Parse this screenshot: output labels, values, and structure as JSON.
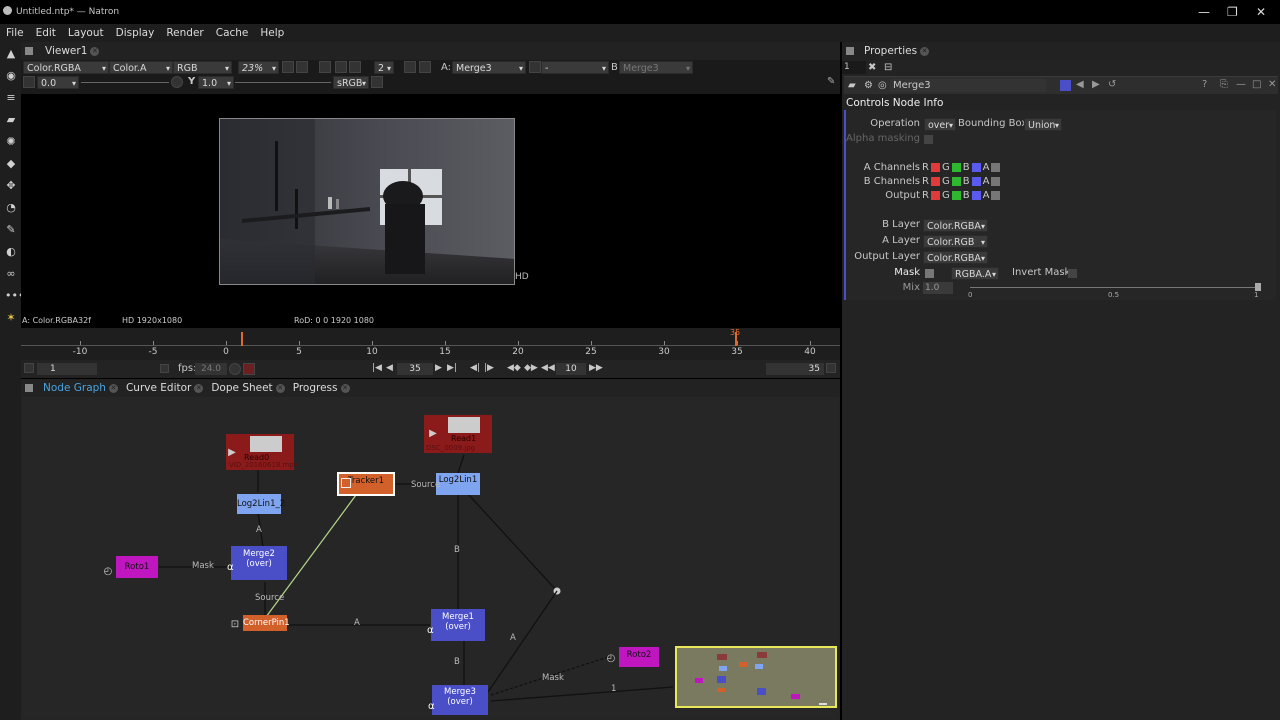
{
  "window": {
    "title": "Untitled.ntp* — Natron",
    "controls": [
      "—",
      "❐",
      "✕"
    ]
  },
  "menu": [
    "File",
    "Edit",
    "Layout",
    "Display",
    "Render",
    "Cache",
    "Help"
  ],
  "viewer": {
    "tab_label": "Viewer1",
    "layer_combo": "Color.RGBA",
    "alpha_combo": "Color.A",
    "display_combo": "RGB",
    "zoom": "23%",
    "proxy_level": "2",
    "gain_value": "0.0",
    "gamma_label": "Y",
    "gamma_value": "1.0",
    "colorspace": "sRGB",
    "input_a_label": "A:",
    "input_a": "Merge3",
    "op_combo": "-",
    "input_b_label": "B:",
    "input_b": "Merge3",
    "hd_label": "HD",
    "info_layer": "A: Color.RGBA32f",
    "info_format": "HD 1920x1080",
    "info_rod": "RoD: 0 0 1920 1080",
    "timeline_ticks": [
      "-10",
      "-5",
      "0",
      "5",
      "10",
      "15",
      "20",
      "25",
      "30",
      "35",
      "40"
    ],
    "cursor_frame": "35",
    "start_frame": "1",
    "fps_label": "fps:",
    "fps_value": "24.0",
    "current_frame": "35",
    "increment": "10",
    "end_frame": "35"
  },
  "graph": {
    "tabs": [
      "Node Graph",
      "Curve Editor",
      "Dope Sheet",
      "Progress"
    ],
    "nodes": {
      "read0": "Read0",
      "read0_sub": "VID_20160618.mp4",
      "read1": "Read1",
      "read1_sub": "DSC_0009.jpg",
      "log2lin1_2": "Log2Lin1_2",
      "tracker1": "Tracker1",
      "log2lin1": "Log2Lin1",
      "roto1": "Roto1",
      "merge2": "Merge2",
      "merge2_op": "(over)",
      "cornerpin1": "CornerPin1",
      "merge1": "Merge1",
      "merge1_op": "(over)",
      "roto2": "Roto2",
      "merge3": "Merge3",
      "merge3_op": "(over)"
    },
    "edge_labels": {
      "source1": "Source",
      "a1": "A",
      "mask1": "Mask",
      "source2": "Source",
      "b1": "B",
      "a2": "A",
      "a3": "A",
      "b2": "B",
      "mask2": "Mask",
      "one": "1"
    }
  },
  "properties": {
    "tab_label": "Properties",
    "max_panels": "1",
    "node_name": "Merge3",
    "subtabs": [
      "Controls",
      "Node",
      "Info"
    ],
    "operation_label": "Operation",
    "operation_value": "over",
    "bbox_label": "Bounding Box",
    "bbox_value": "Union",
    "alpha_masking_label": "Alpha masking",
    "a_channels_label": "A Channels",
    "b_channels_label": "B Channels",
    "output_label": "Output",
    "channel_letters": [
      "R",
      "G",
      "B",
      "A"
    ],
    "b_layer_label": "B Layer",
    "b_layer_value": "Color.RGBA",
    "a_layer_label": "A Layer",
    "a_layer_value": "Color.RGB",
    "output_layer_label": "Output Layer",
    "output_layer_value": "Color.RGBA",
    "mask_label": "Mask",
    "mask_channel": "RGBA.A",
    "invert_mask_label": "Invert Mask",
    "mix_label": "Mix",
    "mix_value": "1.0",
    "mix_ticks": [
      "0",
      "0.5",
      "1"
    ],
    "mix_level": 1.0
  },
  "colors": {
    "read_node": "#8b1a1a",
    "log2lin_node": "#7fa4f0",
    "tracker_node": "#d2602a",
    "roto_node": "#c016c0",
    "merge_node": "#4a4fc8",
    "cornerpin_node": "#d2602a",
    "accent": "#4aa3e0"
  }
}
